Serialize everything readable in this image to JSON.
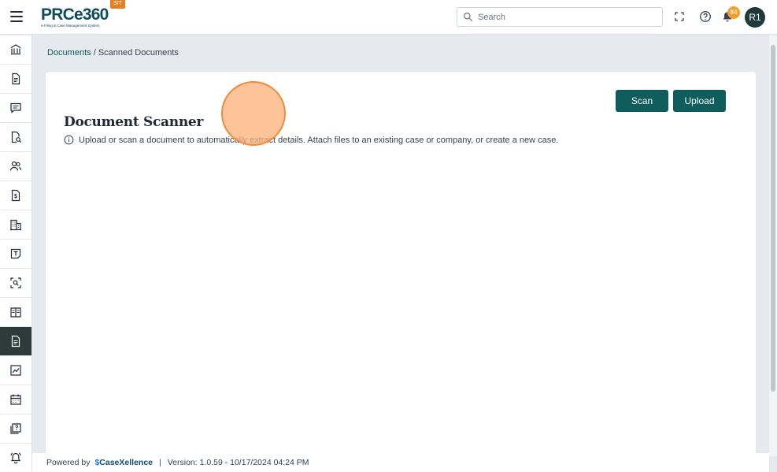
{
  "header": {
    "logo_text": "PRCe360",
    "logo_subtext": "e-Filing & Case Management System",
    "env_badge": "SIT",
    "search_placeholder": "Search",
    "notification_count": "84",
    "avatar_initials": "R1"
  },
  "sidebar": {
    "items": [
      {
        "icon": "bank-icon"
      },
      {
        "icon": "document-icon"
      },
      {
        "icon": "chat-icon"
      },
      {
        "icon": "document-search-icon"
      },
      {
        "icon": "users-icon"
      },
      {
        "icon": "dollar-document-icon"
      },
      {
        "icon": "building-icon"
      },
      {
        "icon": "template-icon"
      },
      {
        "icon": "scan-search-icon"
      },
      {
        "icon": "book-icon"
      },
      {
        "icon": "scanned-document-icon",
        "active": true
      },
      {
        "icon": "chart-icon"
      },
      {
        "icon": "calendar-icon"
      },
      {
        "icon": "help-document-icon"
      },
      {
        "icon": "bell-ring-icon"
      }
    ]
  },
  "breadcrumb": {
    "link": "Documents",
    "separator": " / ",
    "current": "Scanned Documents"
  },
  "main": {
    "title": "Document Scanner",
    "subtitle": "Upload or scan a document to automatically extract details. Attach files to an existing case or company, or create a new case.",
    "scan_label": "Scan",
    "upload_label": "Upload"
  },
  "footer": {
    "powered_by": "Powered by",
    "brand": "CaseXellence",
    "separator": "|",
    "version": "Version: 1.0.59 - 10/17/2024 04:24 PM"
  },
  "colors": {
    "primary": "#0f5c5c",
    "active_sidebar": "#2d3b3b",
    "badge": "#e67e22",
    "notification": "#f0a030"
  }
}
